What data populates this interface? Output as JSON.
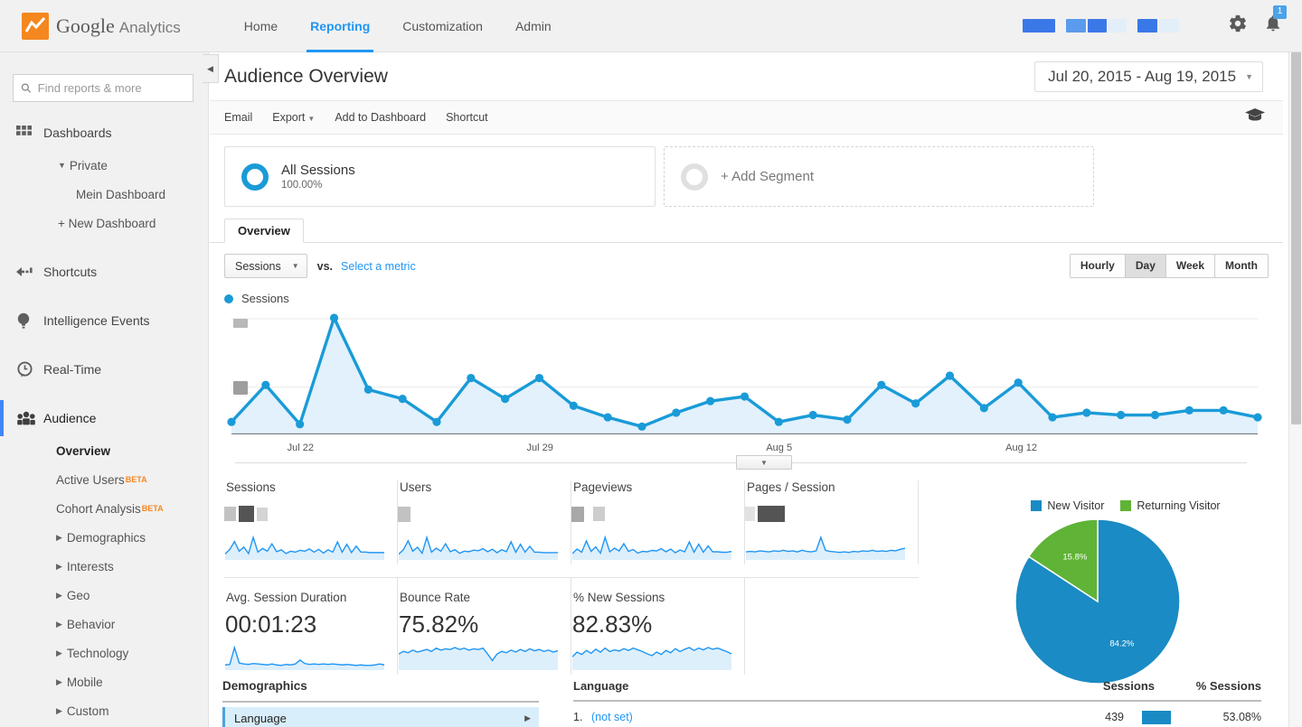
{
  "brand": {
    "name": "Google",
    "product": "Analytics",
    "accent_orange": "#f5871f",
    "accent_blue": "#2196f3"
  },
  "topnav": {
    "items": [
      {
        "label": "Home",
        "active": false
      },
      {
        "label": "Reporting",
        "active": true
      },
      {
        "label": "Customization",
        "active": false
      },
      {
        "label": "Admin",
        "active": false
      }
    ],
    "gear_icon": "gear-icon",
    "bell_icon": "bell-icon",
    "bell_badge": "1"
  },
  "sidebar": {
    "search_placeholder": "Find reports & more",
    "search_value": "",
    "search_icon": "search-icon",
    "items": [
      {
        "label": "Dashboards",
        "icon": "grid-icon"
      },
      {
        "label": "Private",
        "icon": "caret-down-icon"
      },
      {
        "label": "Mein Dashboard",
        "icon": ""
      },
      {
        "label": "+ New Dashboard",
        "icon": ""
      },
      {
        "label": "Shortcuts",
        "icon": "arrow-shortcut-icon"
      },
      {
        "label": "Intelligence Events",
        "icon": "bulb-icon"
      },
      {
        "label": "Real-Time",
        "icon": "clock-icon"
      },
      {
        "label": "Audience",
        "icon": "people-icon"
      }
    ],
    "audience_sub": [
      {
        "label": "Overview",
        "bold": true,
        "beta": "",
        "caret": false
      },
      {
        "label": "Active Users",
        "bold": false,
        "beta": "BETA",
        "caret": false
      },
      {
        "label": "Cohort Analysis",
        "bold": false,
        "beta": "BETA",
        "caret": false
      },
      {
        "label": "Demographics",
        "bold": false,
        "beta": "",
        "caret": true
      },
      {
        "label": "Interests",
        "bold": false,
        "beta": "",
        "caret": true
      },
      {
        "label": "Geo",
        "bold": false,
        "beta": "",
        "caret": true
      },
      {
        "label": "Behavior",
        "bold": false,
        "beta": "",
        "caret": true
      },
      {
        "label": "Technology",
        "bold": false,
        "beta": "",
        "caret": true
      },
      {
        "label": "Mobile",
        "bold": false,
        "beta": "",
        "caret": true
      },
      {
        "label": "Custom",
        "bold": false,
        "beta": "",
        "caret": true
      }
    ],
    "collapse_icon": "caret-left-icon"
  },
  "page": {
    "title": "Audience Overview",
    "date_range": "Jul 20, 2015 - Aug 19, 2015",
    "toolbar": [
      {
        "label": "Email",
        "caret": false
      },
      {
        "label": "Export",
        "caret": true
      },
      {
        "label": "Add to Dashboard",
        "caret": false
      },
      {
        "label": "Shortcut",
        "caret": false
      }
    ],
    "help_icon": "graduation-cap-icon"
  },
  "segments": {
    "all_sessions_label": "All Sessions",
    "all_sessions_pct": "100.00%",
    "add_segment_label": "+ Add Segment"
  },
  "tabs": [
    {
      "label": "Overview",
      "active": true
    }
  ],
  "metric_controls": {
    "selected_metric": "Sessions",
    "vs_label": "vs.",
    "select_metric_label": "Select a metric",
    "granularity": [
      {
        "label": "Hourly",
        "on": false
      },
      {
        "label": "Day",
        "on": true
      },
      {
        "label": "Week",
        "on": false
      },
      {
        "label": "Month",
        "on": false
      }
    ]
  },
  "chart_legend": {
    "series_label": "Sessions",
    "color": "#1a9bd7"
  },
  "cards": [
    {
      "title": "Sessions",
      "value": "",
      "redacted": true
    },
    {
      "title": "Users",
      "value": "",
      "redacted": true
    },
    {
      "title": "Pageviews",
      "value": "",
      "redacted": true
    },
    {
      "title": "Pages / Session",
      "value": "",
      "redacted": true
    },
    {
      "title": "Avg. Session Duration",
      "value": "00:01:23",
      "redacted": false
    },
    {
      "title": "Bounce Rate",
      "value": "75.82%",
      "redacted": false
    },
    {
      "title": "% New Sessions",
      "value": "82.83%",
      "redacted": false
    }
  ],
  "bottom": {
    "left_header": "Demographics",
    "left_item": "Language",
    "left_item_arrow": "caret-right-icon",
    "columns": [
      "Language",
      "Sessions",
      "% Sessions"
    ],
    "rows": [
      {
        "rank": "1.",
        "language": "(not set)",
        "sessions": "439",
        "pct": "53.08%",
        "bar_pct": 53.08
      }
    ]
  },
  "chart_data": [
    {
      "type": "line",
      "title": "Sessions",
      "xlabel": "",
      "ylabel": "Sessions",
      "legend_position": "top-left",
      "grid": true,
      "axis_labels_redacted": true,
      "tick_labels": [
        "Jul 22",
        "Jul 29",
        "Aug 5",
        "Aug 12"
      ],
      "x": [
        "Jul 20",
        "Jul 21",
        "Jul 22",
        "Jul 23",
        "Jul 24",
        "Jul 25",
        "Jul 26",
        "Jul 27",
        "Jul 28",
        "Jul 29",
        "Jul 30",
        "Jul 31",
        "Aug 1",
        "Aug 2",
        "Aug 3",
        "Aug 4",
        "Aug 5",
        "Aug 6",
        "Aug 7",
        "Aug 8",
        "Aug 9",
        "Aug 10",
        "Aug 11",
        "Aug 12",
        "Aug 13",
        "Aug 14",
        "Aug 15",
        "Aug 16",
        "Aug 17",
        "Aug 18",
        "Aug 19"
      ],
      "series": [
        {
          "name": "Sessions",
          "color": "#1a9bd7",
          "values": [
            10,
            42,
            8,
            100,
            38,
            30,
            10,
            48,
            30,
            48,
            24,
            14,
            6,
            18,
            28,
            32,
            10,
            16,
            12,
            42,
            26,
            50,
            22,
            44,
            14,
            18,
            16,
            16,
            20,
            20,
            14
          ]
        }
      ]
    },
    {
      "type": "pie",
      "title": "New vs Returning",
      "legend_position": "top",
      "labels": [
        "New Visitor",
        "Returning Visitor"
      ],
      "values": [
        84.2,
        15.8
      ],
      "value_labels": [
        "84.2%",
        "15.8%"
      ],
      "colors": [
        "#1a8bc4",
        "#5fb336"
      ]
    },
    {
      "type": "line",
      "title": "Sessions sparkline",
      "color": "#2196f3",
      "values": [
        18,
        38,
        72,
        30,
        48,
        20,
        90,
        26,
        42,
        30,
        62,
        28,
        36,
        20,
        30,
        26,
        34,
        30,
        40,
        26,
        38,
        22,
        36,
        26,
        70,
        26,
        60,
        24,
        52,
        26,
        26,
        24,
        24,
        24,
        24
      ]
    },
    {
      "type": "line",
      "title": "Users sparkline",
      "color": "#2196f3",
      "values": [
        16,
        34,
        70,
        28,
        44,
        20,
        84,
        24,
        40,
        28,
        58,
        26,
        34,
        20,
        28,
        26,
        32,
        30,
        38,
        26,
        36,
        22,
        34,
        26,
        66,
        24,
        56,
        24,
        48,
        24,
        24,
        22,
        22,
        22,
        22
      ]
    },
    {
      "type": "line",
      "title": "Pageviews sparkline",
      "color": "#2196f3",
      "values": [
        20,
        40,
        26,
        76,
        30,
        50,
        22,
        92,
        28,
        44,
        32,
        64,
        30,
        38,
        22,
        30,
        28,
        34,
        32,
        42,
        28,
        40,
        24,
        36,
        28,
        72,
        26,
        62,
        26,
        54,
        28,
        28,
        26,
        26,
        30
      ]
    },
    {
      "type": "line",
      "title": "Pages / Session sparkline",
      "color": "#2196f3",
      "values": [
        24,
        26,
        24,
        28,
        26,
        24,
        28,
        26,
        30,
        26,
        28,
        24,
        30,
        26,
        24,
        28,
        80,
        30,
        26,
        24,
        22,
        24,
        22,
        26,
        24,
        28,
        26,
        30,
        26,
        28,
        26,
        30,
        28,
        34,
        38
      ]
    },
    {
      "type": "line",
      "title": "Avg. Session Duration sparkline",
      "color": "#2196f3",
      "values": [
        14,
        16,
        86,
        22,
        18,
        16,
        20,
        18,
        16,
        14,
        18,
        14,
        12,
        16,
        14,
        18,
        34,
        20,
        16,
        18,
        16,
        18,
        16,
        18,
        16,
        14,
        16,
        14,
        12,
        14,
        12,
        12,
        14,
        18,
        14
      ]
    },
    {
      "type": "line",
      "title": "Bounce Rate sparkline",
      "color": "#2196f3",
      "values": [
        44,
        52,
        48,
        56,
        50,
        54,
        58,
        52,
        62,
        56,
        60,
        58,
        64,
        58,
        62,
        56,
        60,
        58,
        62,
        44,
        24,
        44,
        52,
        48,
        56,
        50,
        58,
        52,
        60,
        54,
        58,
        52,
        56,
        50,
        54
      ]
    },
    {
      "type": "line",
      "title": "% New Sessions sparkline",
      "color": "#2196f3",
      "values": [
        40,
        56,
        48,
        62,
        52,
        66,
        56,
        70,
        58,
        64,
        60,
        68,
        62,
        70,
        64,
        58,
        50,
        44,
        56,
        48,
        62,
        54,
        68,
        58,
        66,
        72,
        62,
        70,
        64,
        72,
        66,
        70,
        64,
        58,
        50
      ]
    }
  ]
}
